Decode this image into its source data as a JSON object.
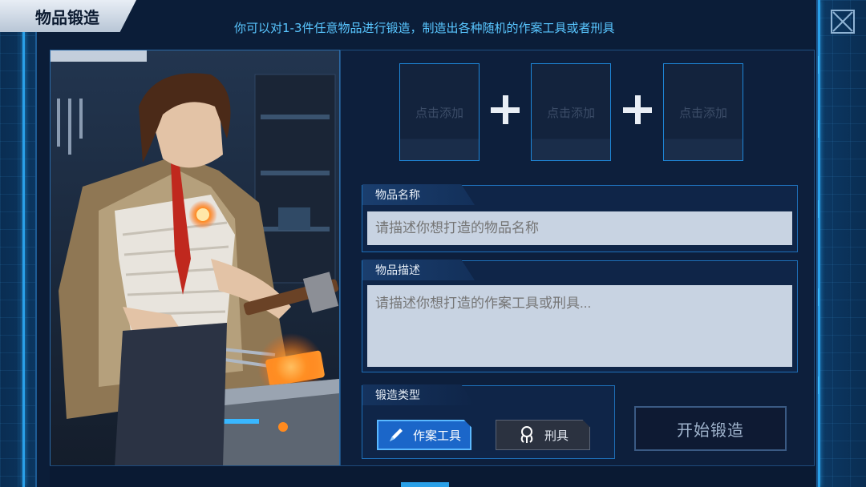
{
  "window": {
    "title": "物品锻造",
    "subtitle": "你可以对1-3件任意物品进行锻造，制造出各种随机的作案工具或者刑具"
  },
  "slots": [
    {
      "label": "点击添加"
    },
    {
      "label": "点击添加"
    },
    {
      "label": "点击添加"
    }
  ],
  "item_name": {
    "label": "物品名称",
    "placeholder": "请描述你想打造的物品名称"
  },
  "item_desc": {
    "label": "物品描述",
    "placeholder": "请描述你想打造的作案工具或刑具..."
  },
  "forge_type": {
    "label": "锻造类型",
    "options": [
      {
        "label": "作案工具",
        "icon": "pen-icon",
        "selected": true
      },
      {
        "label": "刑具",
        "icon": "rope-icon",
        "selected": false
      }
    ]
  },
  "start_button": {
    "label": "开始锻造"
  },
  "colors": {
    "accent": "#2aa0e8",
    "panel": "#0b1d38",
    "selected": "#1b66c9"
  }
}
